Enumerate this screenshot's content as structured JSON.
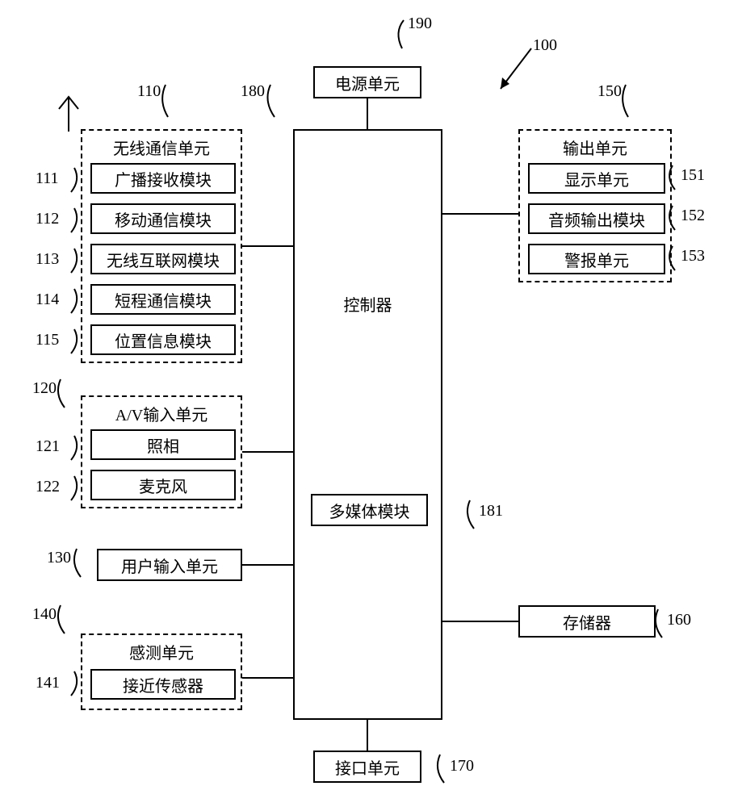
{
  "ref190": "190",
  "ref100": "100",
  "ref110": "110",
  "ref180": "180",
  "ref150": "150",
  "ref111": "111",
  "ref112": "112",
  "ref113": "113",
  "ref114": "114",
  "ref115": "115",
  "ref120": "120",
  "ref121": "121",
  "ref122": "122",
  "ref130": "130",
  "ref140": "140",
  "ref141": "141",
  "ref151": "151",
  "ref152": "152",
  "ref153": "153",
  "ref160": "160",
  "ref170": "170",
  "ref181": "181",
  "power_unit": "电源单元",
  "wireless_unit": "无线通信单元",
  "broadcast_module": "广播接收模块",
  "mobile_module": "移动通信模块",
  "wifi_module": "无线互联网模块",
  "short_range_module": "短程通信模块",
  "location_module": "位置信息模块",
  "av_input_unit": "A/V输入单元",
  "camera": "照相",
  "microphone": "麦克风",
  "user_input_unit": "用户输入单元",
  "sensing_unit": "感测单元",
  "proximity_sensor": "接近传感器",
  "controller": "控制器",
  "multimedia_module": "多媒体模块",
  "output_unit": "输出单元",
  "display_unit": "显示单元",
  "audio_output_module": "音频输出模块",
  "alarm_unit": "警报单元",
  "memory": "存储器",
  "interface_unit": "接口单元"
}
